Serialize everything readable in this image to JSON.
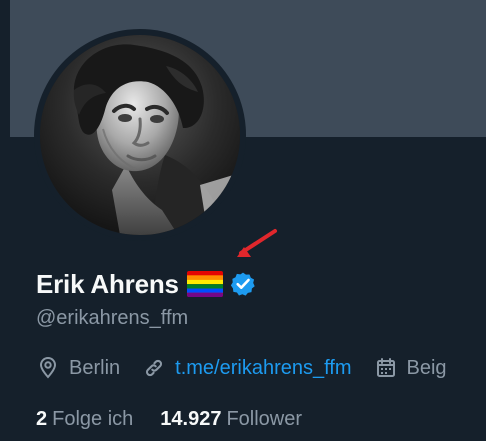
{
  "profile": {
    "display_name": "Erik Ahrens",
    "handle": "@erikahrens_ffm",
    "name_badges": {
      "flag": "rainbow-flag-icon",
      "verified": "verified-badge-icon"
    },
    "location": "Berlin",
    "link": "t.me/erikahrens_ffm",
    "joined": "Beig"
  },
  "stats": {
    "following_count": "2",
    "following_label": "Folge ich",
    "followers_count": "14.927",
    "followers_label": "Follower"
  },
  "icons": {
    "location": "location-pin-icon",
    "link": "link-icon",
    "calendar": "calendar-icon",
    "annotation": "red-arrow-icon"
  },
  "colors": {
    "background": "#15202b",
    "banner": "#3e4b59",
    "primary_text": "#f7f9f9",
    "secondary_text": "#8b98a5",
    "link": "#1d9bf0",
    "verified": "#1d9bf0",
    "annotation": "#e0272c"
  }
}
